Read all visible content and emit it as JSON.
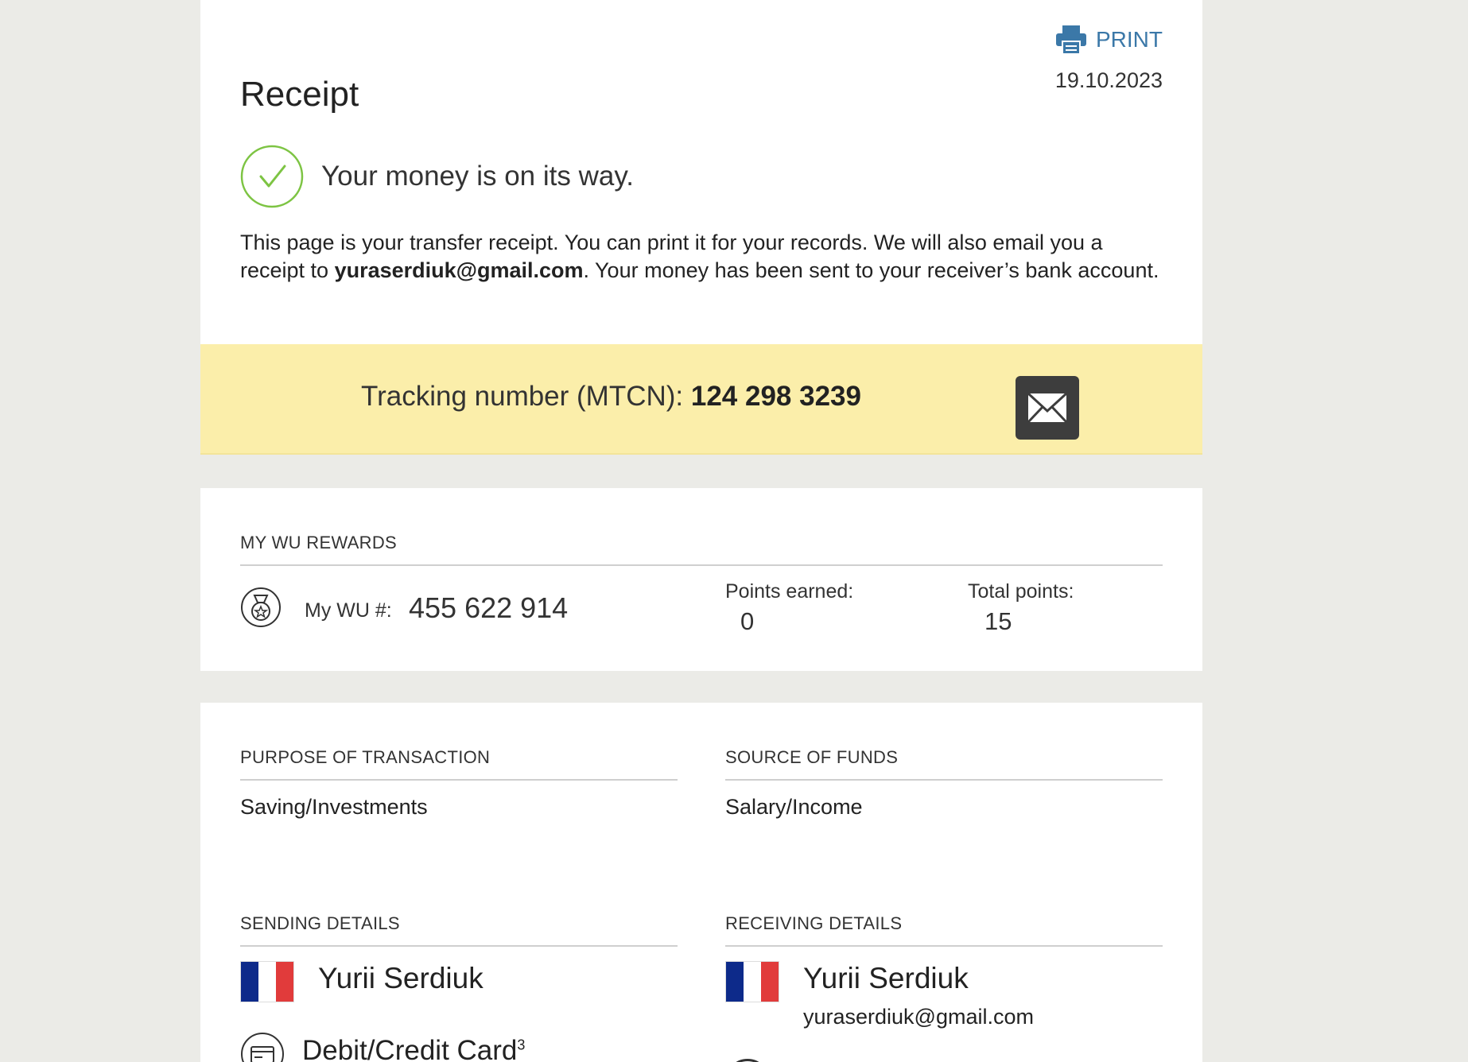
{
  "header": {
    "print_label": "PRINT",
    "date": "19.10.2023",
    "title": "Receipt"
  },
  "status": {
    "message": "Your money is on its way."
  },
  "intro": {
    "text_before": "This page is your transfer receipt. You can print it for your records. We will also email you a receipt to ",
    "email": "yuraserdiuk@gmail.com",
    "text_after": ". Your money has been sent to your receiver’s bank account."
  },
  "tracking": {
    "label": "Tracking number (MTCN): ",
    "number": "124 298 3239"
  },
  "rewards": {
    "heading": "MY WU REWARDS",
    "wu_label": "My WU #:",
    "wu_number": "455 622 914",
    "points_earned_label": "Points earned:",
    "points_earned_value": "0",
    "total_points_label": "Total points:",
    "total_points_value": "15"
  },
  "purpose": {
    "heading": "PURPOSE OF TRANSACTION",
    "value": "Saving/Investments"
  },
  "source": {
    "heading": "SOURCE OF FUNDS",
    "value": "Salary/Income"
  },
  "sending": {
    "heading": "SENDING DETAILS",
    "name": "Yurii Serdiuk",
    "payment_method": "Debit/Credit Card",
    "footnote": "3"
  },
  "receiving": {
    "heading": "RECEIVING DETAILS",
    "name": "Yurii Serdiuk",
    "email": "yuraserdiuk@gmail.com"
  },
  "colors": {
    "accent_blue": "#3b78a8",
    "success_green": "#7dc443",
    "tracking_band": "#fbeeaa",
    "page_background": "#ebebe7"
  },
  "icons": {
    "print": "printer-icon",
    "status": "check-circle-icon",
    "email": "envelope-icon",
    "rewards": "medal-icon",
    "payment": "credit-card-icon",
    "flag": "france-flag-icon"
  }
}
